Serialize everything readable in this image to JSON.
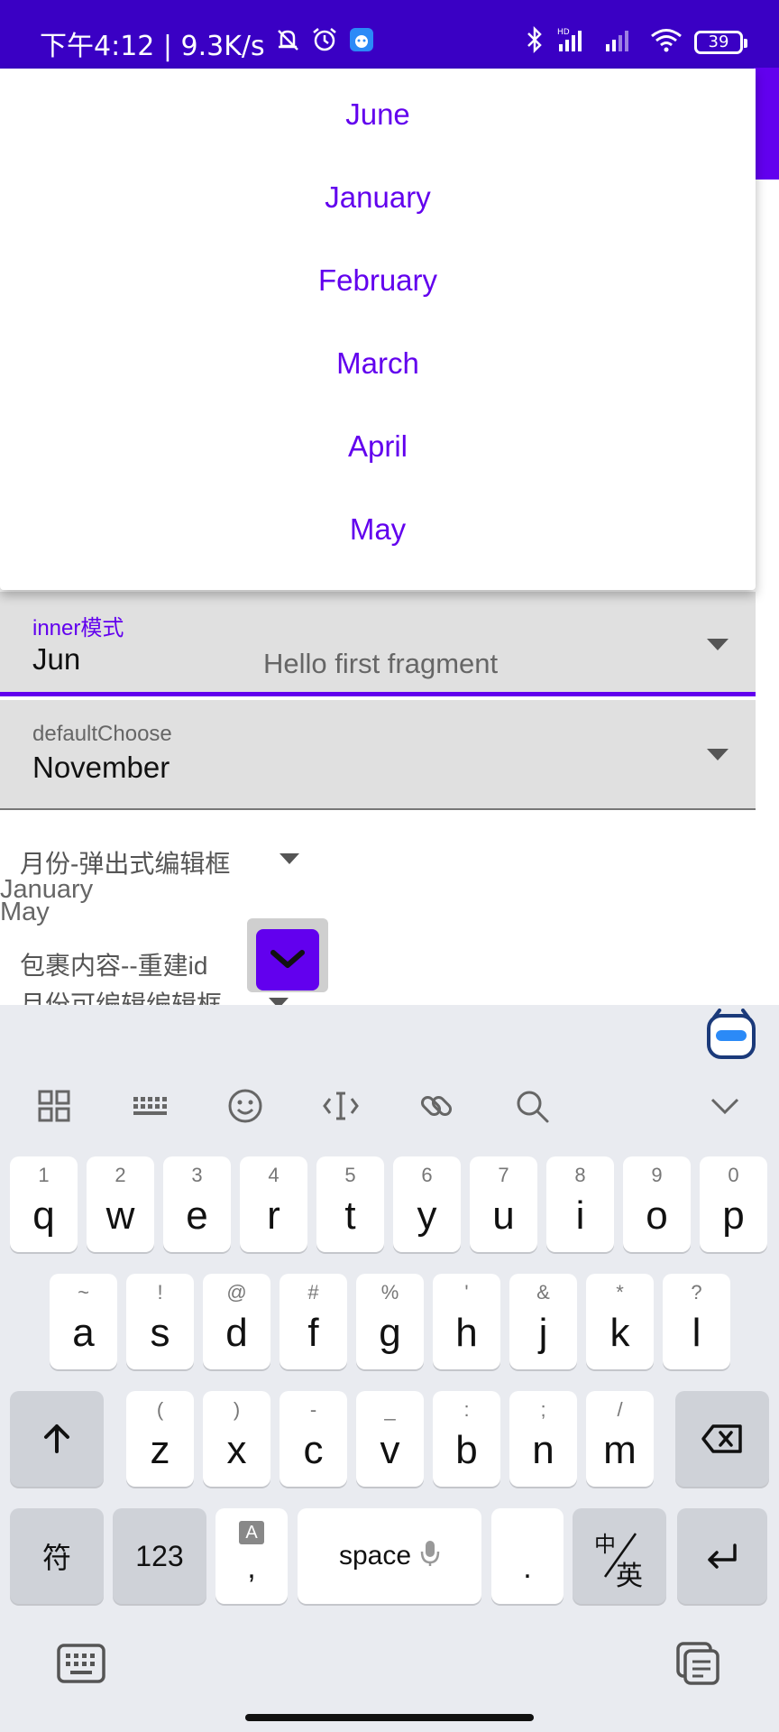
{
  "status_bar": {
    "time_speed": "下午4:12 | 9.3K/s",
    "battery": "39",
    "icons": [
      "mute-bell-icon",
      "alarm-icon",
      "app-icon",
      "bluetooth-icon",
      "signal-hd-icon",
      "signal-icon",
      "wifi-icon",
      "battery-icon"
    ]
  },
  "popup": {
    "items": [
      "June",
      "January",
      "February",
      "March",
      "April",
      "May"
    ]
  },
  "inner_field": {
    "label": "inner模式",
    "value": "Jun"
  },
  "hello_text": "Hello first fragment",
  "default_field": {
    "label": "defaultChoose",
    "value": "November"
  },
  "popup_spinner": {
    "label": "月份-弹出式编辑框"
  },
  "list_items": [
    "January",
    "May"
  ],
  "wrap_label": "包裹内容--重建id",
  "editable_spinner": {
    "label": "月份可编辑编辑框"
  },
  "keyboard": {
    "toolbar_icons": [
      "grid-icon",
      "keyboard-layout-icon",
      "emoji-icon",
      "cursor-icon",
      "link-icon",
      "search-icon",
      "collapse-icon"
    ],
    "row1": [
      {
        "hint": "1",
        "key": "q"
      },
      {
        "hint": "2",
        "key": "w"
      },
      {
        "hint": "3",
        "key": "e"
      },
      {
        "hint": "4",
        "key": "r"
      },
      {
        "hint": "5",
        "key": "t"
      },
      {
        "hint": "6",
        "key": "y"
      },
      {
        "hint": "7",
        "key": "u"
      },
      {
        "hint": "8",
        "key": "i"
      },
      {
        "hint": "9",
        "key": "o"
      },
      {
        "hint": "0",
        "key": "p"
      }
    ],
    "row2": [
      {
        "hint": "~",
        "key": "a"
      },
      {
        "hint": "!",
        "key": "s"
      },
      {
        "hint": "@",
        "key": "d"
      },
      {
        "hint": "#",
        "key": "f"
      },
      {
        "hint": "%",
        "key": "g"
      },
      {
        "hint": "'",
        "key": "h"
      },
      {
        "hint": "&",
        "key": "j"
      },
      {
        "hint": "*",
        "key": "k"
      },
      {
        "hint": "?",
        "key": "l"
      }
    ],
    "row3": [
      {
        "hint": "(",
        "key": "z"
      },
      {
        "hint": ")",
        "key": "x"
      },
      {
        "hint": "-",
        "key": "c"
      },
      {
        "hint": "_",
        "key": "v"
      },
      {
        "hint": ":",
        "key": "b"
      },
      {
        "hint": ";",
        "key": "n"
      },
      {
        "hint": "/",
        "key": "m"
      }
    ],
    "symbols_label": "符",
    "numbers_label": "123",
    "comma_hint": "A",
    "comma_label": ",",
    "space_label": "space",
    "period_label": ".",
    "lang_top": "中",
    "lang_bottom": "英"
  },
  "colors": {
    "status_bar": "#3a00c4",
    "accent": "#6200ee",
    "field_bg": "#e0e0e0",
    "keyboard_bg": "#e9ebf0"
  }
}
